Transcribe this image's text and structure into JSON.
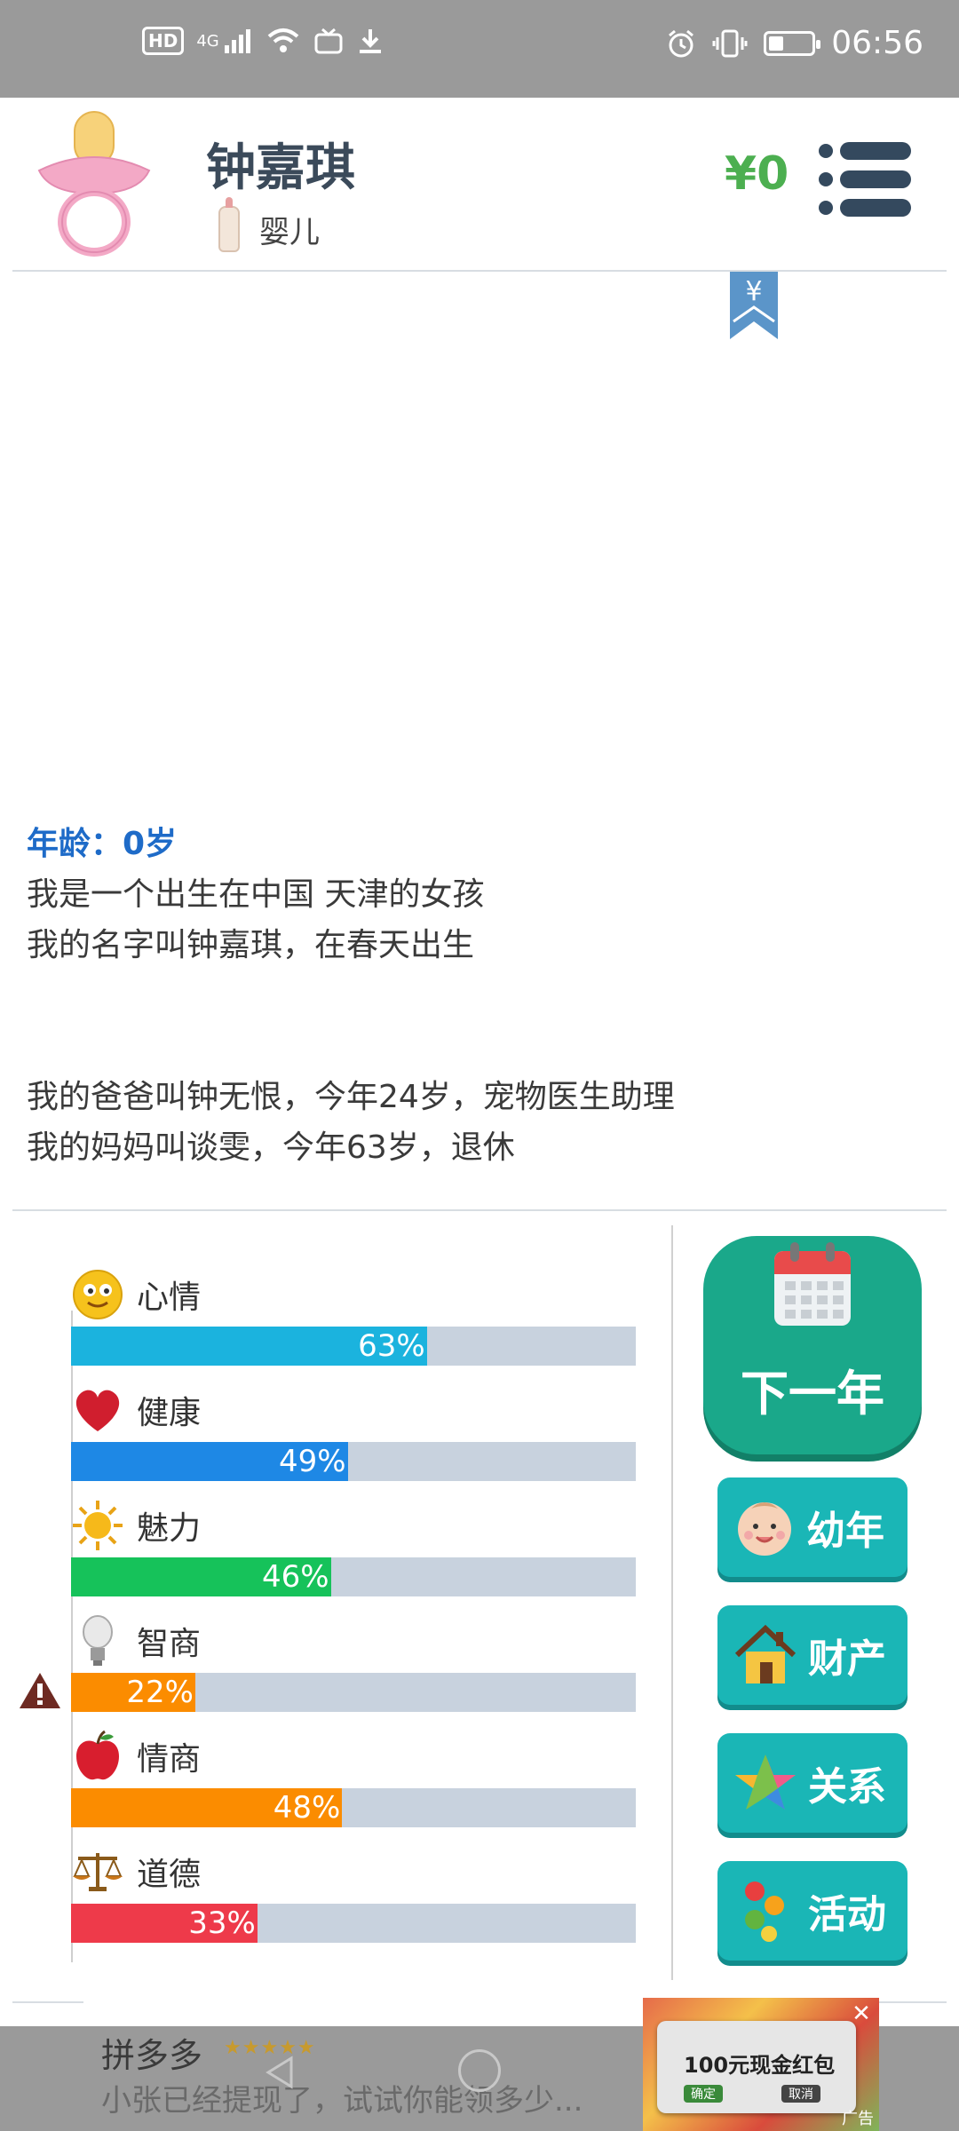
{
  "status_bar": {
    "network": "4G",
    "hd": "HD",
    "time": "06:56"
  },
  "profile": {
    "name": "钟嘉琪",
    "stage": "婴儿",
    "money": "¥0",
    "bookmark_symbol": "¥"
  },
  "story": {
    "age_line": "年龄：0岁",
    "lines_a": [
      "我是一个出生在中国 天津的女孩",
      "我的名字叫钟嘉琪，在春天出生"
    ],
    "lines_b": [
      "我的爸爸叫钟无恨，今年24岁，宠物医生助理",
      "我的妈妈叫谈雯，今年63岁，退休"
    ]
  },
  "stats": [
    {
      "label": "心情",
      "value": 63,
      "text": "63%",
      "color": "#1bb3de",
      "icon": "smiley-icon"
    },
    {
      "label": "健康",
      "value": 49,
      "text": "49%",
      "color": "#1e88e5",
      "icon": "heart-icon"
    },
    {
      "label": "魅力",
      "value": 46,
      "text": "46%",
      "color": "#16c25a",
      "icon": "sun-icon"
    },
    {
      "label": "智商",
      "value": 22,
      "text": "22%",
      "color": "#fb8c00",
      "icon": "lightbulb-icon"
    },
    {
      "label": "情商",
      "value": 48,
      "text": "48%",
      "color": "#fb8c00",
      "icon": "apple-icon"
    },
    {
      "label": "道德",
      "value": 33,
      "text": "33%",
      "color": "#ee3a4a",
      "icon": "scales-icon"
    }
  ],
  "actions": {
    "next_year": "下一年",
    "childhood": "幼年",
    "property": "财产",
    "relations": "关系",
    "activities": "活动"
  },
  "ad": {
    "app_name": "拼多多",
    "stars": "★★★★★",
    "desc": "小张已经提现了，试试你能领多少...",
    "card_text": "100元现金红包",
    "confirm": "确定",
    "cancel": "取消",
    "tag": "广告"
  }
}
